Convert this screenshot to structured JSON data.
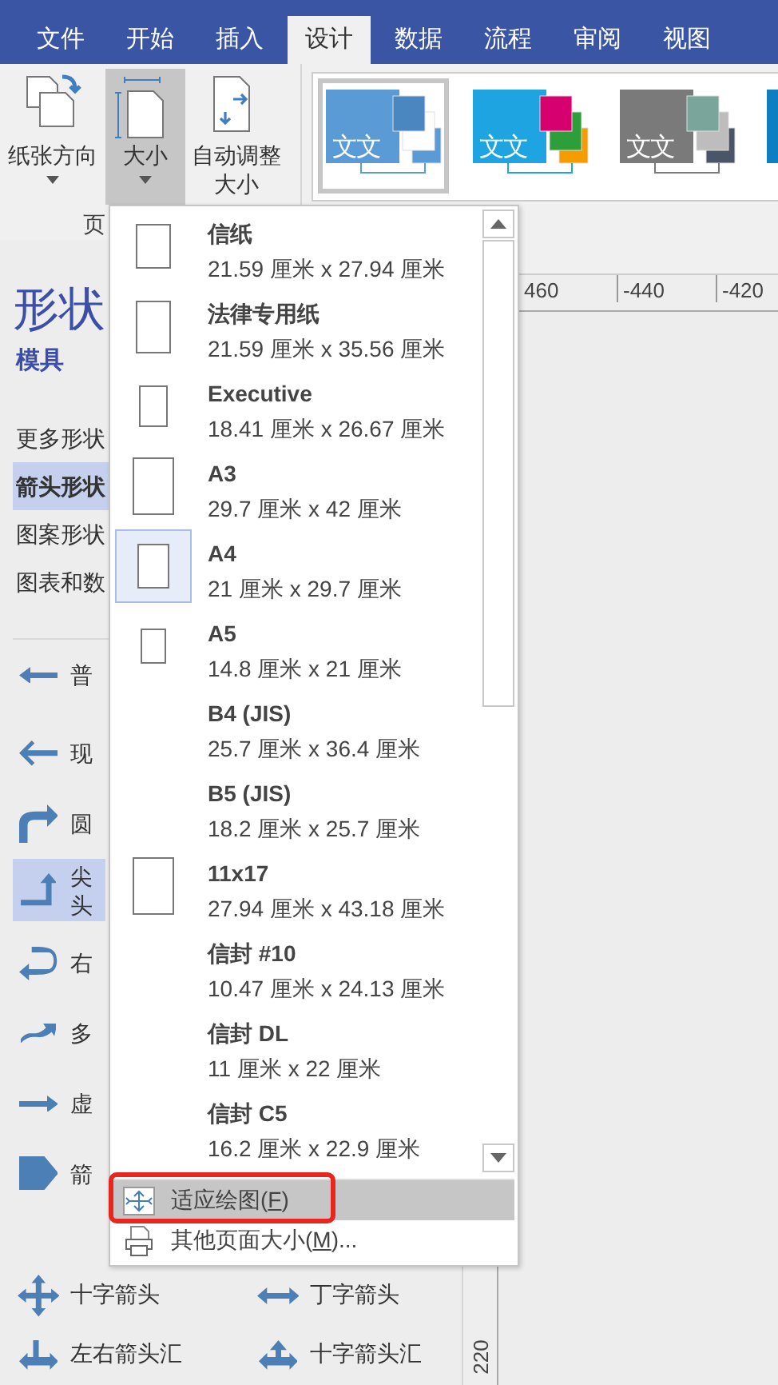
{
  "tabs": [
    {
      "label": "文件",
      "selected": false
    },
    {
      "label": "开始",
      "selected": false
    },
    {
      "label": "插入",
      "selected": false
    },
    {
      "label": "设计",
      "selected": true
    },
    {
      "label": "数据",
      "selected": false
    },
    {
      "label": "流程",
      "selected": false
    },
    {
      "label": "审阅",
      "selected": false
    },
    {
      "label": "视图",
      "selected": false
    }
  ],
  "ribbon": {
    "buttons": [
      {
        "label": "纸张方向",
        "kind": "orientation",
        "has_menu": true,
        "pressed": false
      },
      {
        "label": "大小",
        "kind": "size",
        "has_menu": true,
        "pressed": true
      },
      {
        "label": "自动调整大小",
        "kind": "autofit",
        "has_menu": false,
        "pressed": false
      }
    ],
    "group_label": "页",
    "themes": [
      {
        "label": "文文",
        "selected": true,
        "color": "#5b9bd5",
        "swatches": [
          {
            "color": "#4a86c0"
          },
          {
            "color": "#ffffff"
          },
          {
            "color": "#5b9bd5"
          }
        ]
      },
      {
        "label": "文文",
        "selected": false,
        "color": "#1ea4e0",
        "swatches": [
          {
            "color": "#d6006f"
          },
          {
            "color": "#2e9e3a"
          },
          {
            "color": "#f59c00"
          }
        ]
      },
      {
        "label": "文文",
        "selected": false,
        "color": "#7a7a7a",
        "swatches": [
          {
            "color": "#7aa59a"
          },
          {
            "color": "#bdbdbd"
          },
          {
            "color": "#4a5568"
          }
        ]
      },
      {
        "selected": false,
        "color": "#0b7fc1"
      }
    ]
  },
  "shapes_panel": {
    "title": "形状",
    "tab": "模具",
    "categories": [
      {
        "label": "更多形状",
        "selected": false
      },
      {
        "label": "箭头形状",
        "selected": true
      },
      {
        "label": "图案形状",
        "selected": false
      },
      {
        "label": "图表和数",
        "selected": false
      }
    ],
    "shapes": [
      {
        "lines": [
          "普"
        ],
        "kind": "block-left",
        "selected": false
      },
      {
        "lines": [
          "现"
        ],
        "kind": "thin-left",
        "selected": false
      },
      {
        "lines": [
          "圆"
        ],
        "kind": "curve-up",
        "selected": false
      },
      {
        "lines": [
          "尖",
          "头"
        ],
        "kind": "corner-up",
        "selected": true
      },
      {
        "lines": [
          "右"
        ],
        "kind": "u-turn",
        "selected": false
      },
      {
        "lines": [
          "多"
        ],
        "kind": "wave",
        "selected": false
      },
      {
        "lines": [
          "虚"
        ],
        "kind": "block-right",
        "selected": false
      },
      {
        "lines": [
          "箭"
        ],
        "kind": "pentagon",
        "selected": false
      }
    ],
    "grid_shapes": [
      {
        "label": "十字箭头",
        "kind": "quad"
      },
      {
        "label": "丁字箭头",
        "kind": "tee"
      },
      {
        "label": "左右箭头汇",
        "kind": "join"
      },
      {
        "label": "十字箭头汇",
        "kind": "cross-join"
      }
    ]
  },
  "canvas": {
    "ruler_h": [
      "460",
      "-440",
      "-420"
    ],
    "ruler_v": [
      "220"
    ]
  },
  "size_menu": {
    "items": [
      {
        "name": "信纸",
        "size": "21.59 厘米 x 27.94 厘米",
        "kind": "letter",
        "selected": false
      },
      {
        "name": "法律专用纸",
        "size": "21.59 厘米 x 35.56 厘米",
        "kind": "legal",
        "selected": false
      },
      {
        "name": "Executive",
        "size": "18.41 厘米 x 26.67 厘米",
        "kind": "executive",
        "selected": false
      },
      {
        "name": "A3",
        "size": "29.7 厘米 x 42 厘米",
        "kind": "a3",
        "selected": false
      },
      {
        "name": "A4",
        "size": "21 厘米 x 29.7 厘米",
        "kind": "a4",
        "selected": true
      },
      {
        "name": "A5",
        "size": "14.8 厘米 x 21 厘米",
        "kind": "a5",
        "selected": false
      },
      {
        "name": "B4 (JIS)",
        "size": "25.7 厘米 x 36.4 厘米",
        "kind": "plain",
        "selected": false
      },
      {
        "name": "B5 (JIS)",
        "size": "18.2 厘米 x 25.7 厘米",
        "kind": "plain",
        "selected": false
      },
      {
        "name": "11x17",
        "size": "27.94 厘米 x 43.18 厘米",
        "kind": "tabloid",
        "selected": false
      },
      {
        "name": "信封 #10",
        "size": "10.47 厘米 x 24.13 厘米",
        "kind": "plain",
        "selected": false
      },
      {
        "name": "信封 DL",
        "size": "11 厘米 x 22 厘米",
        "kind": "plain",
        "selected": false
      },
      {
        "name": "信封 C5",
        "size": "16.2 厘米 x 22.9 厘米",
        "kind": "plain",
        "selected": false
      }
    ],
    "actions": [
      {
        "before": "适应绘图(",
        "key": "F",
        "after": ")",
        "kind": "fit",
        "highlighted": true,
        "annotated": true
      },
      {
        "before": "其他页面大小(",
        "key": "M",
        "after": ")...",
        "kind": "page-setup",
        "highlighted": false,
        "annotated": false
      }
    ]
  }
}
